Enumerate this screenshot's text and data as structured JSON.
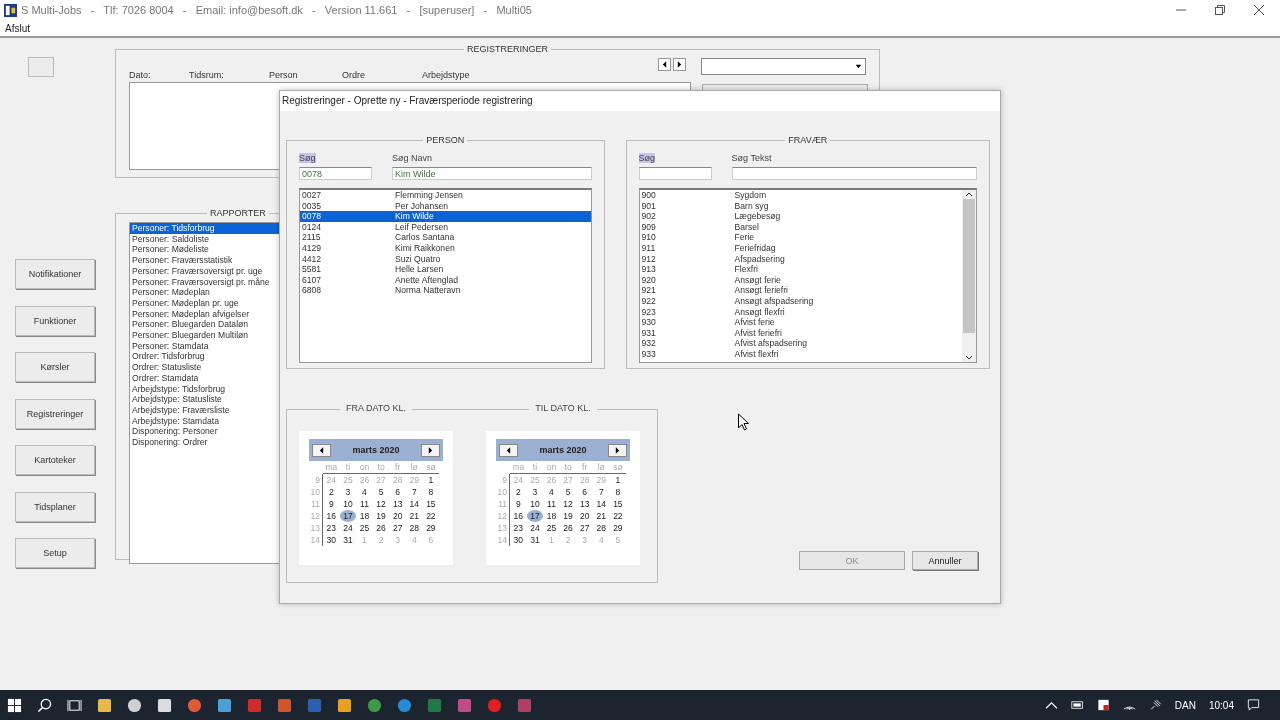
{
  "window": {
    "title": "S Multi-Jobs   -   Tlf: 7026 8004   -   Email: info@besoft.dk   -   Version 11.661   -   [superuser]   -   Multi05"
  },
  "menu": [
    "Afslut"
  ],
  "nav_buttons": [
    "Notifikationer",
    "Funktioner",
    "Kørsler",
    "Registreringer",
    "Kartoteker",
    "Tidsplaner",
    "Setup"
  ],
  "registreringer": {
    "title": "REGISTRERINGER",
    "columns": [
      "Dato:",
      "Tidsrum:",
      "Person",
      "Ordre",
      "Arbejdstype"
    ]
  },
  "rapporter": {
    "title": "RAPPORTER",
    "items": [
      {
        "label": "Personer: Tidsforbrug",
        "selected": true
      },
      {
        "label": "Personer: Saldoliste",
        "selected": false
      },
      {
        "label": "Personer: Mødeliste",
        "selected": false
      },
      {
        "label": "Personer: Fraværsstatistik",
        "selected": false
      },
      {
        "label": "Personer: Fraværsoversigt pr. uge",
        "selected": false
      },
      {
        "label": "Personer: Fraværsoversigt pr. måne",
        "selected": false
      },
      {
        "label": "Personer: Mødeplan",
        "selected": false
      },
      {
        "label": "Personer: Mødeplan pr. uge",
        "selected": false
      },
      {
        "label": "Personer: Mødeplan afvigelser",
        "selected": false
      },
      {
        "label": "Personer: Bluegarden Dataløn",
        "selected": false
      },
      {
        "label": "Personer: Bluegarden Multiløn",
        "selected": false
      },
      {
        "label": "Personer: Stamdata",
        "selected": false
      },
      {
        "label": "Ordrer: Tidsforbrug",
        "selected": false
      },
      {
        "label": "Ordrer: Statusliste",
        "selected": false
      },
      {
        "label": "Ordrer: Stamdata",
        "selected": false
      },
      {
        "label": "Arbejdstype: Tidsforbrug",
        "selected": false
      },
      {
        "label": "Arbejdstype: Statusliste",
        "selected": false
      },
      {
        "label": "Arbejdstype: Fraværsliste",
        "selected": false
      },
      {
        "label": "Arbejdstype: Stamdata",
        "selected": false
      },
      {
        "label": "Disponering: Personer",
        "selected": false
      },
      {
        "label": "Disponering: Ordrer",
        "selected": false
      }
    ]
  },
  "dialog": {
    "title": "Registreringer - Oprette ny - Fraværsperiode registrering",
    "person": {
      "title": "PERSON",
      "search_label": "Søg",
      "search_label_highlighted": true,
      "search_value": "0078",
      "text_label": "Søg Navn",
      "text_value": "Kim Wilde",
      "rows": [
        {
          "code": "0027",
          "text": "Flemming Jensen",
          "selected": false
        },
        {
          "code": "0035",
          "text": "Per Johansen",
          "selected": false
        },
        {
          "code": "0078",
          "text": "Kim Wilde",
          "selected": true
        },
        {
          "code": "0124",
          "text": "Leif Pedersen",
          "selected": false
        },
        {
          "code": "2115",
          "text": "Carlos Santana",
          "selected": false
        },
        {
          "code": "4129",
          "text": "Kimi Raikkonen",
          "selected": false
        },
        {
          "code": "4412",
          "text": "Suzi Quatro",
          "selected": false
        },
        {
          "code": "5581",
          "text": "Helle Larsen",
          "selected": false
        },
        {
          "code": "6107",
          "text": "Anette Aftenglad",
          "selected": false
        },
        {
          "code": "6808",
          "text": "Norma Natteravn",
          "selected": false
        }
      ]
    },
    "fravaer": {
      "title": "FRAVÆR",
      "search_label": "Søg",
      "search_label_highlighted": true,
      "text_label": "Søg Tekst",
      "rows": [
        {
          "code": "900",
          "text": "Sygdom",
          "selected": false
        },
        {
          "code": "901",
          "text": "Barn syg",
          "selected": false
        },
        {
          "code": "902",
          "text": "Lægebesøg",
          "selected": false
        },
        {
          "code": "909",
          "text": "Barsel",
          "selected": false
        },
        {
          "code": "910",
          "text": "Ferie",
          "selected": false
        },
        {
          "code": "911",
          "text": "Feriefridag",
          "selected": false
        },
        {
          "code": "912",
          "text": "Afspadsering",
          "selected": false
        },
        {
          "code": "913",
          "text": "Flexfri",
          "selected": false
        },
        {
          "code": "920",
          "text": "Ansøgt ferie",
          "selected": false
        },
        {
          "code": "921",
          "text": "Ansøgt feriefri",
          "selected": false
        },
        {
          "code": "922",
          "text": "Ansøgt afspadsering",
          "selected": false
        },
        {
          "code": "923",
          "text": "Ansøgt flexfri",
          "selected": false
        },
        {
          "code": "930",
          "text": "Afvist ferie",
          "selected": false
        },
        {
          "code": "931",
          "text": "Afvist feriefri",
          "selected": false
        },
        {
          "code": "932",
          "text": "Afvist afspadsering",
          "selected": false
        },
        {
          "code": "933",
          "text": "Afvist flexfri",
          "selected": false
        }
      ]
    },
    "calendars": [
      {
        "title": "FRA DATO KL.",
        "month": "marts 2020",
        "weekdays": [
          "ma",
          "ti",
          "on",
          "to",
          "fr",
          "lø",
          "sø"
        ],
        "weeks": [
          {
            "number": "9",
            "days": [
              {
                "day": "24",
                "in_month": false,
                "selected": false
              },
              {
                "day": "25",
                "in_month": false,
                "selected": false
              },
              {
                "day": "26",
                "in_month": false,
                "selected": false
              },
              {
                "day": "27",
                "in_month": false,
                "selected": false
              },
              {
                "day": "28",
                "in_month": false,
                "selected": false
              },
              {
                "day": "29",
                "in_month": false,
                "selected": false
              },
              {
                "day": "1",
                "in_month": true,
                "selected": false
              }
            ]
          },
          {
            "number": "10",
            "days": [
              {
                "day": "2",
                "in_month": true,
                "selected": false
              },
              {
                "day": "3",
                "in_month": true,
                "selected": false
              },
              {
                "day": "4",
                "in_month": true,
                "selected": false
              },
              {
                "day": "5",
                "in_month": true,
                "selected": false
              },
              {
                "day": "6",
                "in_month": true,
                "selected": false
              },
              {
                "day": "7",
                "in_month": true,
                "selected": false
              },
              {
                "day": "8",
                "in_month": true,
                "selected": false
              }
            ]
          },
          {
            "number": "11",
            "days": [
              {
                "day": "9",
                "in_month": true,
                "selected": false
              },
              {
                "day": "10",
                "in_month": true,
                "selected": false
              },
              {
                "day": "11",
                "in_month": true,
                "selected": false
              },
              {
                "day": "12",
                "in_month": true,
                "selected": false
              },
              {
                "day": "13",
                "in_month": true,
                "selected": false
              },
              {
                "day": "14",
                "in_month": true,
                "selected": false
              },
              {
                "day": "15",
                "in_month": true,
                "selected": false
              }
            ]
          },
          {
            "number": "12",
            "days": [
              {
                "day": "16",
                "in_month": true,
                "selected": false
              },
              {
                "day": "17",
                "in_month": true,
                "selected": true
              },
              {
                "day": "18",
                "in_month": true,
                "selected": false
              },
              {
                "day": "19",
                "in_month": true,
                "selected": false
              },
              {
                "day": "20",
                "in_month": true,
                "selected": false
              },
              {
                "day": "21",
                "in_month": true,
                "selected": false
              },
              {
                "day": "22",
                "in_month": true,
                "selected": false
              }
            ]
          },
          {
            "number": "13",
            "days": [
              {
                "day": "23",
                "in_month": true,
                "selected": false
              },
              {
                "day": "24",
                "in_month": true,
                "selected": false
              },
              {
                "day": "25",
                "in_month": true,
                "selected": false
              },
              {
                "day": "26",
                "in_month": true,
                "selected": false
              },
              {
                "day": "27",
                "in_month": true,
                "selected": false
              },
              {
                "day": "28",
                "in_month": true,
                "selected": false
              },
              {
                "day": "29",
                "in_month": true,
                "selected": false
              }
            ]
          },
          {
            "number": "14",
            "days": [
              {
                "day": "30",
                "in_month": true,
                "selected": false
              },
              {
                "day": "31",
                "in_month": true,
                "selected": false
              },
              {
                "day": "1",
                "in_month": false,
                "selected": false
              },
              {
                "day": "2",
                "in_month": false,
                "selected": false
              },
              {
                "day": "3",
                "in_month": false,
                "selected": false
              },
              {
                "day": "4",
                "in_month": false,
                "selected": false
              },
              {
                "day": "5",
                "in_month": false,
                "selected": false
              }
            ]
          }
        ]
      },
      {
        "title": "TIL DATO KL.",
        "month": "marts 2020",
        "weekdays": [
          "ma",
          "ti",
          "on",
          "to",
          "fr",
          "lø",
          "sø"
        ],
        "weeks": [
          {
            "number": "9",
            "days": [
              {
                "day": "24",
                "in_month": false,
                "selected": false
              },
              {
                "day": "25",
                "in_month": false,
                "selected": false
              },
              {
                "day": "26",
                "in_month": false,
                "selected": false
              },
              {
                "day": "27",
                "in_month": false,
                "selected": false
              },
              {
                "day": "28",
                "in_month": false,
                "selected": false
              },
              {
                "day": "29",
                "in_month": false,
                "selected": false
              },
              {
                "day": "1",
                "in_month": true,
                "selected": false
              }
            ]
          },
          {
            "number": "10",
            "days": [
              {
                "day": "2",
                "in_month": true,
                "selected": false
              },
              {
                "day": "3",
                "in_month": true,
                "selected": false
              },
              {
                "day": "4",
                "in_month": true,
                "selected": false
              },
              {
                "day": "5",
                "in_month": true,
                "selected": false
              },
              {
                "day": "6",
                "in_month": true,
                "selected": false
              },
              {
                "day": "7",
                "in_month": true,
                "selected": false
              },
              {
                "day": "8",
                "in_month": true,
                "selected": false
              }
            ]
          },
          {
            "number": "11",
            "days": [
              {
                "day": "9",
                "in_month": true,
                "selected": false
              },
              {
                "day": "10",
                "in_month": true,
                "selected": false
              },
              {
                "day": "11",
                "in_month": true,
                "selected": false
              },
              {
                "day": "12",
                "in_month": true,
                "selected": false
              },
              {
                "day": "13",
                "in_month": true,
                "selected": false
              },
              {
                "day": "14",
                "in_month": true,
                "selected": false
              },
              {
                "day": "15",
                "in_month": true,
                "selected": false
              }
            ]
          },
          {
            "number": "12",
            "days": [
              {
                "day": "16",
                "in_month": true,
                "selected": false
              },
              {
                "day": "17",
                "in_month": true,
                "selected": true
              },
              {
                "day": "18",
                "in_month": true,
                "selected": false
              },
              {
                "day": "19",
                "in_month": true,
                "selected": false
              },
              {
                "day": "20",
                "in_month": true,
                "selected": false
              },
              {
                "day": "21",
                "in_month": true,
                "selected": false
              },
              {
                "day": "22",
                "in_month": true,
                "selected": false
              }
            ]
          },
          {
            "number": "13",
            "days": [
              {
                "day": "23",
                "in_month": true,
                "selected": false
              },
              {
                "day": "24",
                "in_month": true,
                "selected": false
              },
              {
                "day": "25",
                "in_month": true,
                "selected": false
              },
              {
                "day": "26",
                "in_month": true,
                "selected": false
              },
              {
                "day": "27",
                "in_month": true,
                "selected": false
              },
              {
                "day": "28",
                "in_month": true,
                "selected": false
              },
              {
                "day": "29",
                "in_month": true,
                "selected": false
              }
            ]
          },
          {
            "number": "14",
            "days": [
              {
                "day": "30",
                "in_month": true,
                "selected": false
              },
              {
                "day": "31",
                "in_month": true,
                "selected": false
              },
              {
                "day": "1",
                "in_month": false,
                "selected": false
              },
              {
                "day": "2",
                "in_month": false,
                "selected": false
              },
              {
                "day": "3",
                "in_month": false,
                "selected": false
              },
              {
                "day": "4",
                "in_month": false,
                "selected": false
              },
              {
                "day": "5",
                "in_month": false,
                "selected": false
              }
            ]
          }
        ]
      }
    ],
    "buttons": [
      {
        "label": "OK",
        "disabled": true
      },
      {
        "label": "Annuller",
        "disabled": false
      }
    ]
  },
  "taskbar": {
    "language": "DAN",
    "time": "10:04"
  }
}
